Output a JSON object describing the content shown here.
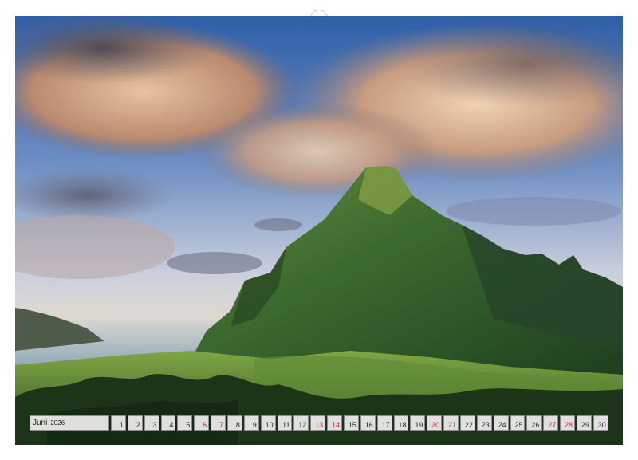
{
  "calendar": {
    "month": "Juni",
    "year": "2026",
    "days": [
      {
        "num": "1",
        "weekend": false
      },
      {
        "num": "2",
        "weekend": false
      },
      {
        "num": "3",
        "weekend": false
      },
      {
        "num": "4",
        "weekend": false
      },
      {
        "num": "5",
        "weekend": false
      },
      {
        "num": "6",
        "weekend": true
      },
      {
        "num": "7",
        "weekend": true
      },
      {
        "num": "8",
        "weekend": false
      },
      {
        "num": "9",
        "weekend": false
      },
      {
        "num": "10",
        "weekend": false
      },
      {
        "num": "11",
        "weekend": false
      },
      {
        "num": "12",
        "weekend": false
      },
      {
        "num": "13",
        "weekend": true
      },
      {
        "num": "14",
        "weekend": true
      },
      {
        "num": "15",
        "weekend": false
      },
      {
        "num": "16",
        "weekend": false
      },
      {
        "num": "17",
        "weekend": false
      },
      {
        "num": "18",
        "weekend": false
      },
      {
        "num": "19",
        "weekend": false
      },
      {
        "num": "20",
        "weekend": true
      },
      {
        "num": "21",
        "weekend": true
      },
      {
        "num": "22",
        "weekend": false
      },
      {
        "num": "23",
        "weekend": false
      },
      {
        "num": "24",
        "weekend": false
      },
      {
        "num": "25",
        "weekend": false
      },
      {
        "num": "26",
        "weekend": false
      },
      {
        "num": "27",
        "weekend": true
      },
      {
        "num": "28",
        "weekend": true
      },
      {
        "num": "29",
        "weekend": false
      },
      {
        "num": "30",
        "weekend": false
      }
    ]
  },
  "colors": {
    "weekend": "#c1272d",
    "sky_blue": "#2f5fa8",
    "cloud_warm": "#d9a57c",
    "mountain": "#2f5a2b",
    "forest": "#1f3a1c",
    "sea": "#9fb8c8"
  }
}
